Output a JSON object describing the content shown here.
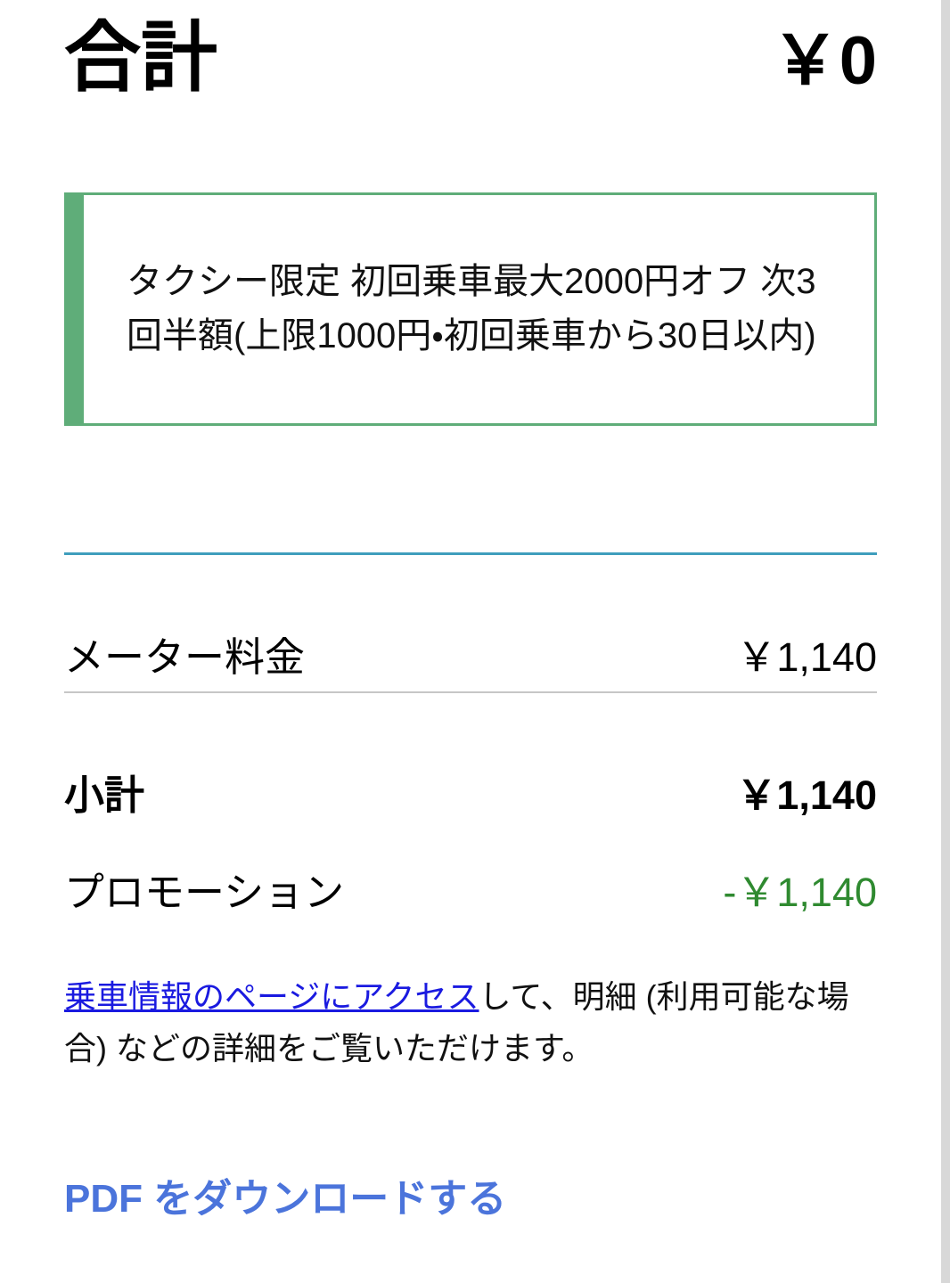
{
  "header": {
    "title": "合計",
    "amount": "￥0"
  },
  "promotion_callout": {
    "text": "タクシー限定 初回乗車最大2000円オフ 次3回半額(上限1000円・初回乗車から30日以内)",
    "accent_color": "#5fad79",
    "border_color": "#5fad79"
  },
  "dividers": {
    "accent_color": "#3f9ebd",
    "light_color": "#c6c6c6"
  },
  "fare_rows": [
    {
      "label": "メーター料金",
      "value": "￥1,140"
    }
  ],
  "summary_rows": [
    {
      "label": "小計",
      "value": "￥1,140"
    },
    {
      "label": "プロモーション",
      "value": "-￥1,140",
      "value_color": "#2f8a30"
    }
  ],
  "info": {
    "link_text": "乗車情報のページにアクセス",
    "rest_text": "して、明細 (利用可能な場合) などの詳細をご覧いただけます。",
    "link_color": "#1a1ae0"
  },
  "pdf": {
    "label": "PDF をダウンロードする",
    "color": "#4b74db"
  }
}
